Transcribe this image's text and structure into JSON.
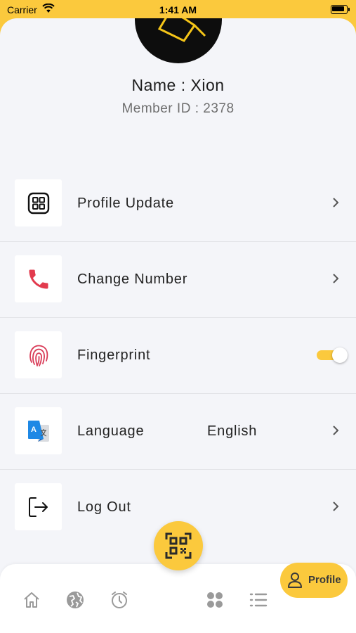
{
  "status_bar": {
    "carrier": "Carrier",
    "time": "1:41 AM"
  },
  "profile": {
    "name": "Name : Xion",
    "member_id": "Member ID : 2378"
  },
  "menu": {
    "profile_update": {
      "label": "Profile Update",
      "icon": "grid-icon"
    },
    "change_number": {
      "label": "Change Number",
      "icon": "phone-icon"
    },
    "fingerprint": {
      "label": "Fingerprint",
      "icon": "fingerprint-icon",
      "enabled": true
    },
    "language": {
      "label": "Language",
      "value": "English",
      "icon": "translate-icon"
    },
    "logout": {
      "label": "Log Out",
      "icon": "logout-icon"
    }
  },
  "bottom_nav": {
    "items": [
      "home-icon",
      "globe-icon",
      "alarm-icon",
      "qr-scan-icon",
      "apps-icon",
      "list-icon",
      "profile-icon"
    ],
    "active_label": "Profile"
  },
  "colors": {
    "accent": "#FBC93D",
    "background": "#F4F5F9",
    "phone": "#E23B4E",
    "translate": "#1E88E5"
  }
}
